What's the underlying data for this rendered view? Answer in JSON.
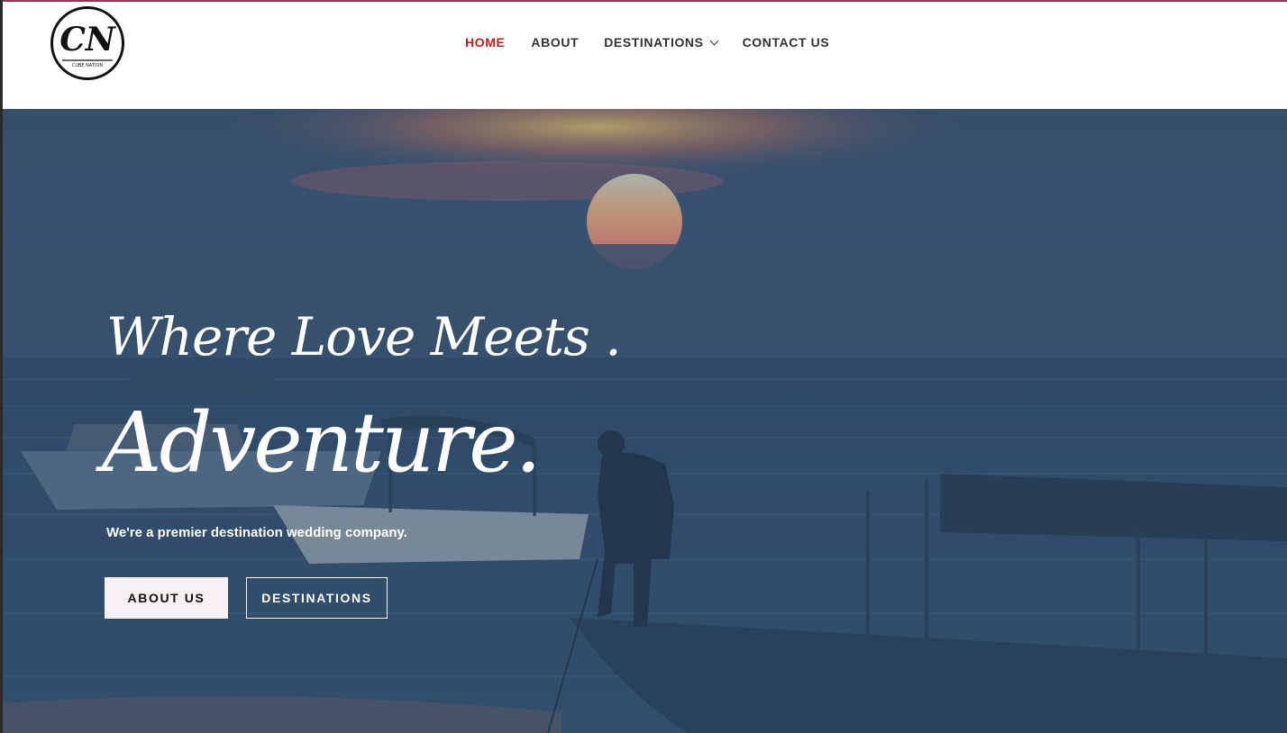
{
  "brand": {
    "logo_text": "CN",
    "logo_subtext": "CUBE NATION"
  },
  "nav": {
    "items": [
      {
        "label": "HOME"
      },
      {
        "label": "ABOUT"
      },
      {
        "label": "DESTINATIONS"
      },
      {
        "label": "CONTACT US"
      }
    ]
  },
  "hero": {
    "headline_line1": "Where Love Meets .",
    "headline_line2": "Adventure.",
    "tagline": "We're a premier destination wedding company.",
    "buttons": {
      "about": "ABOUT US",
      "destinations": "DESTINATIONS"
    }
  },
  "colors": {
    "nav_active": "#c81e1e",
    "nav_text": "#333333",
    "hero_overlay": "#2c4766"
  }
}
